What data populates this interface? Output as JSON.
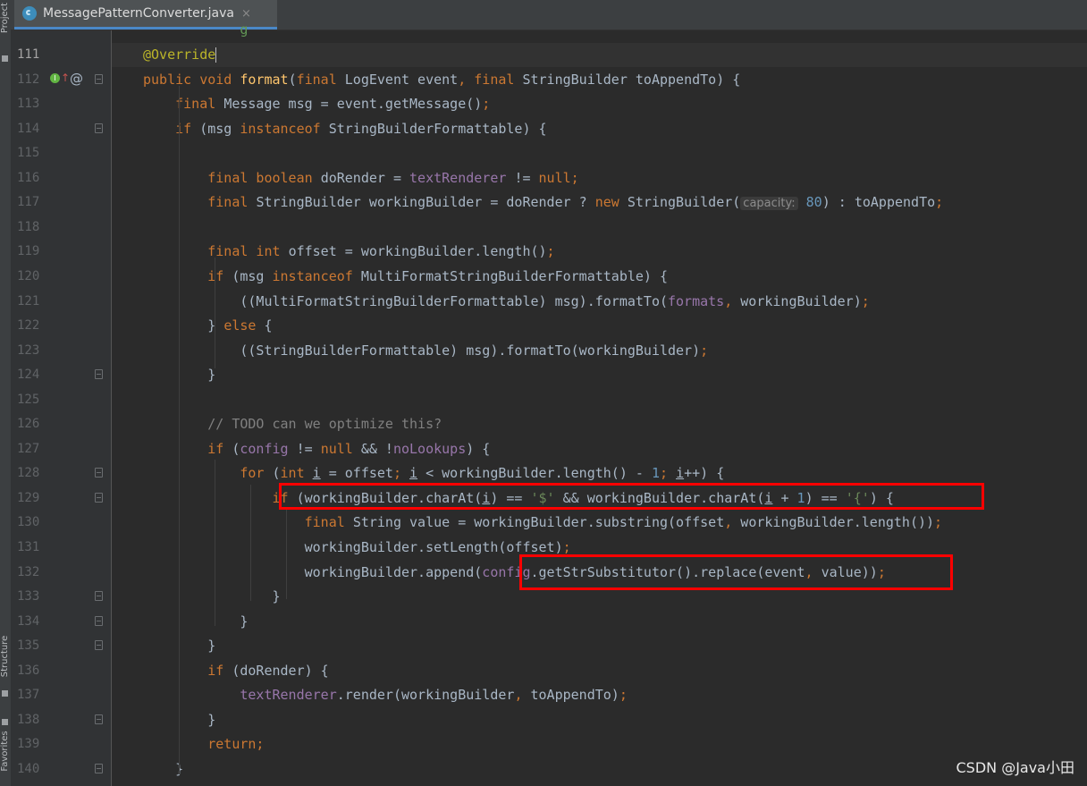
{
  "sidebar": {
    "project_label": "Project",
    "structure_label": "Structure",
    "favorites_label": "Favorites"
  },
  "tab": {
    "title": "MessagePatternConverter.java",
    "close": "×",
    "icon": "java-class-icon"
  },
  "gutter_icons": {
    "implements": "I",
    "arrow": "↑",
    "at": "@"
  },
  "lines": [
    {
      "n": "111",
      "current": true,
      "tokens": [
        [
          "",
          ""
        ],
        [
          "ann",
          "@Override"
        ]
      ],
      "cursor": true
    },
    {
      "n": "112",
      "tokens": [
        [
          "kw",
          "public void "
        ],
        [
          "fn",
          "format"
        ],
        [
          "",
          "("
        ],
        [
          "kw",
          "final "
        ],
        [
          "",
          "LogEvent event"
        ],
        [
          "kw",
          ", final "
        ],
        [
          "",
          "StringBuilder toAppendTo) {"
        ]
      ]
    },
    {
      "n": "113",
      "tokens": [
        [
          "",
          "    "
        ],
        [
          "kw",
          "final "
        ],
        [
          "",
          "Message msg = event.getMessage()"
        ],
        [
          "kw",
          ";"
        ]
      ]
    },
    {
      "n": "114",
      "tokens": [
        [
          "",
          "    "
        ],
        [
          "kw",
          "if "
        ],
        [
          "",
          "(msg "
        ],
        [
          "kw",
          "instanceof "
        ],
        [
          "",
          "StringBuilderFormattable) {"
        ]
      ]
    },
    {
      "n": "115",
      "tokens": []
    },
    {
      "n": "116",
      "tokens": [
        [
          "",
          "        "
        ],
        [
          "kw",
          "final boolean "
        ],
        [
          "",
          "doRender = "
        ],
        [
          "fld",
          "textRenderer "
        ],
        [
          "",
          "!= "
        ],
        [
          "kw",
          "null;"
        ]
      ]
    },
    {
      "n": "117",
      "tokens": [
        [
          "",
          "        "
        ],
        [
          "kw",
          "final "
        ],
        [
          "",
          "StringBuilder workingBuilder = doRender ? "
        ],
        [
          "kw",
          "new "
        ],
        [
          "",
          "StringBuilder("
        ],
        [
          "hint",
          "capacity:"
        ],
        [
          "",
          " "
        ],
        [
          "num",
          "80"
        ],
        [
          "",
          ") : toAppendTo"
        ],
        [
          "kw",
          ";"
        ]
      ]
    },
    {
      "n": "118",
      "tokens": []
    },
    {
      "n": "119",
      "tokens": [
        [
          "",
          "        "
        ],
        [
          "kw",
          "final int "
        ],
        [
          "",
          "offset = workingBuilder.length()"
        ],
        [
          "kw",
          ";"
        ]
      ]
    },
    {
      "n": "120",
      "tokens": [
        [
          "",
          "        "
        ],
        [
          "kw",
          "if "
        ],
        [
          "",
          "(msg "
        ],
        [
          "kw",
          "instanceof "
        ],
        [
          "",
          "MultiFormatStringBuilderFormattable) {"
        ]
      ]
    },
    {
      "n": "121",
      "tokens": [
        [
          "",
          "            ((MultiFormatStringBuilderFormattable) msg).formatTo("
        ],
        [
          "fld",
          "formats"
        ],
        [
          "kw",
          ", "
        ],
        [
          "",
          "workingBuilder)"
        ],
        [
          "kw",
          ";"
        ]
      ]
    },
    {
      "n": "122",
      "tokens": [
        [
          "",
          "        } "
        ],
        [
          "kw",
          "else "
        ],
        [
          "",
          "{"
        ]
      ]
    },
    {
      "n": "123",
      "tokens": [
        [
          "",
          "            ((StringBuilderFormattable) msg).formatTo(workingBuilder)"
        ],
        [
          "kw",
          ";"
        ]
      ]
    },
    {
      "n": "124",
      "tokens": [
        [
          "",
          "        }"
        ]
      ]
    },
    {
      "n": "125",
      "tokens": []
    },
    {
      "n": "126",
      "tokens": [
        [
          "",
          "        "
        ],
        [
          "cmt",
          "// TODO can we optimize this?"
        ]
      ]
    },
    {
      "n": "127",
      "tokens": [
        [
          "",
          "        "
        ],
        [
          "kw",
          "if "
        ],
        [
          "",
          "("
        ],
        [
          "fld",
          "config "
        ],
        [
          "",
          "!= "
        ],
        [
          "kw",
          "null "
        ],
        [
          "",
          "&& !"
        ],
        [
          "fld",
          "noLookups"
        ],
        [
          "",
          ") {"
        ]
      ]
    },
    {
      "n": "128",
      "tokens": [
        [
          "",
          "            "
        ],
        [
          "kw",
          "for "
        ],
        [
          "",
          "("
        ],
        [
          "kw",
          "int "
        ],
        [
          "ul",
          "i"
        ],
        [
          "",
          " = offset"
        ],
        [
          "kw",
          "; "
        ],
        [
          "ul",
          "i"
        ],
        [
          "",
          " < workingBuilder.length() - "
        ],
        [
          "num",
          "1"
        ],
        [
          "kw",
          "; "
        ],
        [
          "ul",
          "i"
        ],
        [
          "",
          "++) {"
        ]
      ]
    },
    {
      "n": "129",
      "tokens": [
        [
          "",
          "                "
        ],
        [
          "kw",
          "if "
        ],
        [
          "",
          "(workingBuilder.charAt("
        ],
        [
          "ul",
          "i"
        ],
        [
          "",
          ") == "
        ],
        [
          "str",
          "'$' "
        ],
        [
          "",
          "&& workingBuilder.charAt("
        ],
        [
          "ul",
          "i"
        ],
        [
          "",
          " + "
        ],
        [
          "num",
          "1"
        ],
        [
          "",
          ") == "
        ],
        [
          "str",
          "'{'"
        ],
        [
          "",
          ") {"
        ]
      ]
    },
    {
      "n": "130",
      "tokens": [
        [
          "",
          "                    "
        ],
        [
          "kw",
          "final "
        ],
        [
          "",
          "String value = workingBuilder.substring(offset"
        ],
        [
          "kw",
          ", "
        ],
        [
          "",
          "workingBuilder.length())"
        ],
        [
          "kw",
          ";"
        ]
      ]
    },
    {
      "n": "131",
      "tokens": [
        [
          "",
          "                    workingBuilder.setLength(offset)"
        ],
        [
          "kw",
          ";"
        ]
      ]
    },
    {
      "n": "132",
      "tokens": [
        [
          "",
          "                    workingBuilder.append("
        ],
        [
          "fld",
          "config"
        ],
        [
          "",
          ".getStrSubstitutor().replace(event"
        ],
        [
          "kw",
          ", "
        ],
        [
          "",
          "value))"
        ],
        [
          "kw",
          ";"
        ]
      ]
    },
    {
      "n": "133",
      "tokens": [
        [
          "",
          "                }"
        ]
      ]
    },
    {
      "n": "134",
      "tokens": [
        [
          "",
          "            }"
        ]
      ]
    },
    {
      "n": "135",
      "tokens": [
        [
          "",
          "        }"
        ]
      ]
    },
    {
      "n": "136",
      "tokens": [
        [
          "",
          "        "
        ],
        [
          "kw",
          "if "
        ],
        [
          "",
          "(doRender) {"
        ]
      ]
    },
    {
      "n": "137",
      "tokens": [
        [
          "",
          "            "
        ],
        [
          "fld",
          "textRenderer"
        ],
        [
          "",
          ".render(workingBuilder"
        ],
        [
          "kw",
          ", "
        ],
        [
          "",
          "toAppendTo)"
        ],
        [
          "kw",
          ";"
        ]
      ]
    },
    {
      "n": "138",
      "tokens": [
        [
          "",
          "        }"
        ]
      ]
    },
    {
      "n": "139",
      "tokens": [
        [
          "",
          "        "
        ],
        [
          "kw",
          "return;"
        ]
      ]
    },
    {
      "n": "140",
      "tokens": [
        [
          "",
          "    }"
        ]
      ]
    }
  ],
  "watermark": "CSDN @Java小田",
  "colors": {
    "background": "#2b2b2b",
    "keyword": "#cc7832",
    "field": "#9876aa",
    "method": "#ffc66d",
    "number": "#6897bb",
    "string": "#6a8759",
    "annotation": "#bbb529",
    "highlight_box": "#ff0000"
  }
}
